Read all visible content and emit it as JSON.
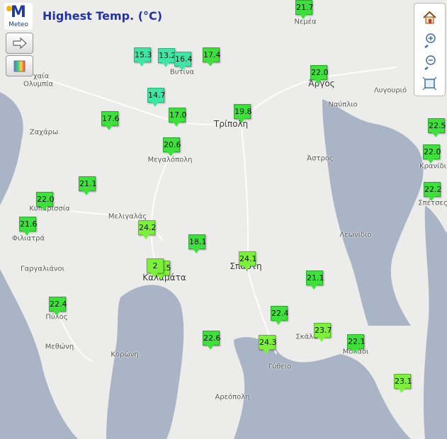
{
  "title": "Highest Temp. (°C)",
  "logo": {
    "text": "M",
    "subtitle": "Meteo"
  },
  "controls": {
    "side": [
      "arrow-right-icon",
      "color-scale-icon"
    ],
    "toolbar": [
      "home-icon",
      "zoom-in-icon",
      "zoom-out-icon",
      "fit-extent-icon"
    ]
  },
  "places": [
    {
      "name": "Νεμέα",
      "big": false
    },
    {
      "name": "Άργος",
      "big": true
    },
    {
      "name": "Ναύπλιο",
      "big": false
    },
    {
      "name": "Λυγουριό",
      "big": false
    },
    {
      "name": "Βυτίνα",
      "big": false
    },
    {
      "name": "Τρίπολη",
      "big": true
    },
    {
      "name": "Άστρος",
      "big": false
    },
    {
      "name": "Κρανίδι",
      "big": false
    },
    {
      "name": "Σπέτσες",
      "big": false
    },
    {
      "name": "Μεγαλόπολη",
      "big": false
    },
    {
      "name": "Κυπαρισσία",
      "big": false
    },
    {
      "name": "Μελιγαλάς",
      "big": false
    },
    {
      "name": "Φιλιατρά",
      "big": false
    },
    {
      "name": "Λεωνίδιο",
      "big": false
    },
    {
      "name": "Σπάρτη",
      "big": true
    },
    {
      "name": "Γαργαλιάνοι",
      "big": false
    },
    {
      "name": "Καλαμάτα",
      "big": true
    },
    {
      "name": "Πύλος",
      "big": false
    },
    {
      "name": "Μεθώνη",
      "big": false
    },
    {
      "name": "Κορώνη",
      "big": false
    },
    {
      "name": "Σκάλα",
      "big": false
    },
    {
      "name": "Μολάοι",
      "big": false
    },
    {
      "name": "Γύθειο",
      "big": false
    },
    {
      "name": "Αρεόπολη",
      "big": false
    },
    {
      "name": "Ζαχάρω",
      "big": false
    },
    {
      "name": "χαία",
      "big": false
    },
    {
      "name": "Ολυμπία",
      "big": false
    }
  ],
  "stations": [
    {
      "value": "21.7",
      "color": "green"
    },
    {
      "value": "22.0",
      "color": "green"
    },
    {
      "value": "15.3",
      "color": "teal"
    },
    {
      "value": "13.2",
      "color": "teal"
    },
    {
      "value": "16.4",
      "color": "teal"
    },
    {
      "value": "17.4",
      "color": "green"
    },
    {
      "value": "14.7",
      "color": "teal"
    },
    {
      "value": "17.0",
      "color": "green"
    },
    {
      "value": "19.8",
      "color": "green"
    },
    {
      "value": "17.6",
      "color": "green"
    },
    {
      "value": "20.6",
      "color": "green"
    },
    {
      "value": "22.5",
      "color": "green"
    },
    {
      "value": "22.0",
      "color": "green"
    },
    {
      "value": "22.2",
      "color": "green"
    },
    {
      "value": "21.1",
      "color": "green"
    },
    {
      "value": "22.0",
      "color": "green"
    },
    {
      "value": "21.6",
      "color": "green"
    },
    {
      "value": "24.2",
      "color": "lime"
    },
    {
      "value": "18.1",
      "color": "green"
    },
    {
      "value": "24.1",
      "color": "lime"
    },
    {
      "value": "24.5",
      "color": "lime"
    },
    {
      "value": "2",
      "color": "lime"
    },
    {
      "value": "21.1",
      "color": "green"
    },
    {
      "value": "22.4",
      "color": "green"
    },
    {
      "value": "22.4",
      "color": "green"
    },
    {
      "value": "23.7",
      "color": "lime"
    },
    {
      "value": "22.6",
      "color": "green"
    },
    {
      "value": "24.3",
      "color": "lime"
    },
    {
      "value": "22.1",
      "color": "green"
    },
    {
      "value": "23.1",
      "color": "lime"
    }
  ]
}
